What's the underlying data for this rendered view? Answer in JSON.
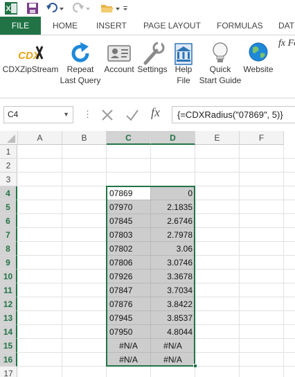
{
  "ribbon_tabs": [
    "FILE",
    "HOME",
    "INSERT",
    "PAGE LAYOUT",
    "FORMULAS",
    "DAT"
  ],
  "ribbon": {
    "cdx_logo": "CDX",
    "buttons": [
      {
        "line1": "CDXZipStream",
        "line2": "",
        "icon": "cdx-logo-icon"
      },
      {
        "line1": "Repeat",
        "line2": "Last Query",
        "icon": "refresh-icon"
      },
      {
        "line1": "Account",
        "line2": "",
        "icon": "account-card-icon"
      },
      {
        "line1": "Settings",
        "line2": "",
        "icon": "wrench-icon"
      },
      {
        "line1": "Help",
        "line2": "File",
        "icon": "help-file-icon"
      },
      {
        "line1": "Quick",
        "line2": "Start Guide",
        "icon": "lightbulb-icon"
      },
      {
        "line1": "Website",
        "line2": "",
        "icon": "globe-icon"
      }
    ],
    "fx_partial": "Fo"
  },
  "formula_bar": {
    "name_box": "C4",
    "fx": "fx",
    "formula": "{=CDXRadius(\"07869\", 5)}"
  },
  "columns": [
    "A",
    "B",
    "C",
    "D",
    "E",
    "F"
  ],
  "selected_columns": [
    "C",
    "D"
  ],
  "rows": [
    "1",
    "2",
    "3",
    "4",
    "5",
    "6",
    "7",
    "8",
    "9",
    "10",
    "11",
    "12",
    "13",
    "14",
    "15",
    "16",
    "17"
  ],
  "selected_rows": [
    "4",
    "5",
    "6",
    "7",
    "8",
    "9",
    "10",
    "11",
    "12",
    "13",
    "14",
    "15",
    "16"
  ],
  "active_cell": "C4",
  "data_rows": [
    {
      "row": "4",
      "c": "07869",
      "d": "0"
    },
    {
      "row": "5",
      "c": "07970",
      "d": "2.1835"
    },
    {
      "row": "6",
      "c": "07845",
      "d": "2.6746"
    },
    {
      "row": "7",
      "c": "07803",
      "d": "2.7978"
    },
    {
      "row": "8",
      "c": "07802",
      "d": "3.06"
    },
    {
      "row": "9",
      "c": "07806",
      "d": "3.0746"
    },
    {
      "row": "10",
      "c": "07926",
      "d": "3.3678"
    },
    {
      "row": "11",
      "c": "07847",
      "d": "3.7034"
    },
    {
      "row": "12",
      "c": "07876",
      "d": "3.8422"
    },
    {
      "row": "13",
      "c": "07945",
      "d": "3.8537"
    },
    {
      "row": "14",
      "c": "07950",
      "d": "4.8044"
    },
    {
      "row": "15",
      "c": "#N/A",
      "d": "#N/A"
    },
    {
      "row": "16",
      "c": "#N/A",
      "d": "#N/A"
    }
  ],
  "colors": {
    "accent": "#217346",
    "selection_fill": "#cdcdcd"
  }
}
